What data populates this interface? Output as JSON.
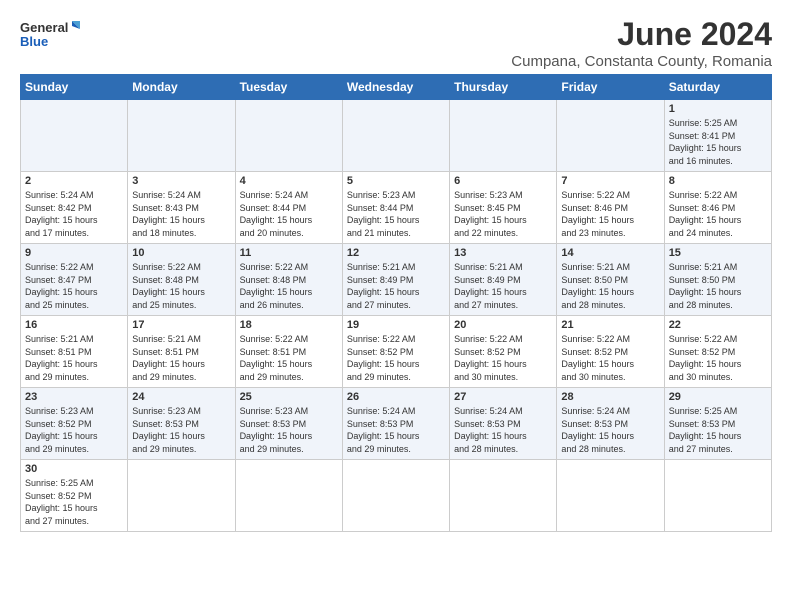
{
  "logo": {
    "text_general": "General",
    "text_blue": "Blue"
  },
  "title": "June 2024",
  "subtitle": "Cumpana, Constanta County, Romania",
  "weekdays": [
    "Sunday",
    "Monday",
    "Tuesday",
    "Wednesday",
    "Thursday",
    "Friday",
    "Saturday"
  ],
  "weeks": [
    [
      {
        "day": "",
        "info": ""
      },
      {
        "day": "",
        "info": ""
      },
      {
        "day": "",
        "info": ""
      },
      {
        "day": "",
        "info": ""
      },
      {
        "day": "",
        "info": ""
      },
      {
        "day": "",
        "info": ""
      },
      {
        "day": "1",
        "info": "Sunrise: 5:25 AM\nSunset: 8:41 PM\nDaylight: 15 hours\nand 16 minutes."
      }
    ],
    [
      {
        "day": "2",
        "info": "Sunrise: 5:24 AM\nSunset: 8:42 PM\nDaylight: 15 hours\nand 17 minutes."
      },
      {
        "day": "3",
        "info": "Sunrise: 5:24 AM\nSunset: 8:43 PM\nDaylight: 15 hours\nand 18 minutes."
      },
      {
        "day": "4",
        "info": "Sunrise: 5:24 AM\nSunset: 8:44 PM\nDaylight: 15 hours\nand 20 minutes."
      },
      {
        "day": "5",
        "info": "Sunrise: 5:23 AM\nSunset: 8:44 PM\nDaylight: 15 hours\nand 21 minutes."
      },
      {
        "day": "6",
        "info": "Sunrise: 5:23 AM\nSunset: 8:45 PM\nDaylight: 15 hours\nand 22 minutes."
      },
      {
        "day": "7",
        "info": "Sunrise: 5:22 AM\nSunset: 8:46 PM\nDaylight: 15 hours\nand 23 minutes."
      },
      {
        "day": "8",
        "info": "Sunrise: 5:22 AM\nSunset: 8:46 PM\nDaylight: 15 hours\nand 24 minutes."
      }
    ],
    [
      {
        "day": "9",
        "info": "Sunrise: 5:22 AM\nSunset: 8:47 PM\nDaylight: 15 hours\nand 25 minutes."
      },
      {
        "day": "10",
        "info": "Sunrise: 5:22 AM\nSunset: 8:48 PM\nDaylight: 15 hours\nand 25 minutes."
      },
      {
        "day": "11",
        "info": "Sunrise: 5:22 AM\nSunset: 8:48 PM\nDaylight: 15 hours\nand 26 minutes."
      },
      {
        "day": "12",
        "info": "Sunrise: 5:21 AM\nSunset: 8:49 PM\nDaylight: 15 hours\nand 27 minutes."
      },
      {
        "day": "13",
        "info": "Sunrise: 5:21 AM\nSunset: 8:49 PM\nDaylight: 15 hours\nand 27 minutes."
      },
      {
        "day": "14",
        "info": "Sunrise: 5:21 AM\nSunset: 8:50 PM\nDaylight: 15 hours\nand 28 minutes."
      },
      {
        "day": "15",
        "info": "Sunrise: 5:21 AM\nSunset: 8:50 PM\nDaylight: 15 hours\nand 28 minutes."
      }
    ],
    [
      {
        "day": "16",
        "info": "Sunrise: 5:21 AM\nSunset: 8:51 PM\nDaylight: 15 hours\nand 29 minutes."
      },
      {
        "day": "17",
        "info": "Sunrise: 5:21 AM\nSunset: 8:51 PM\nDaylight: 15 hours\nand 29 minutes."
      },
      {
        "day": "18",
        "info": "Sunrise: 5:22 AM\nSunset: 8:51 PM\nDaylight: 15 hours\nand 29 minutes."
      },
      {
        "day": "19",
        "info": "Sunrise: 5:22 AM\nSunset: 8:52 PM\nDaylight: 15 hours\nand 29 minutes."
      },
      {
        "day": "20",
        "info": "Sunrise: 5:22 AM\nSunset: 8:52 PM\nDaylight: 15 hours\nand 30 minutes."
      },
      {
        "day": "21",
        "info": "Sunrise: 5:22 AM\nSunset: 8:52 PM\nDaylight: 15 hours\nand 30 minutes."
      },
      {
        "day": "22",
        "info": "Sunrise: 5:22 AM\nSunset: 8:52 PM\nDaylight: 15 hours\nand 30 minutes."
      }
    ],
    [
      {
        "day": "23",
        "info": "Sunrise: 5:23 AM\nSunset: 8:52 PM\nDaylight: 15 hours\nand 29 minutes."
      },
      {
        "day": "24",
        "info": "Sunrise: 5:23 AM\nSunset: 8:53 PM\nDaylight: 15 hours\nand 29 minutes."
      },
      {
        "day": "25",
        "info": "Sunrise: 5:23 AM\nSunset: 8:53 PM\nDaylight: 15 hours\nand 29 minutes."
      },
      {
        "day": "26",
        "info": "Sunrise: 5:24 AM\nSunset: 8:53 PM\nDaylight: 15 hours\nand 29 minutes."
      },
      {
        "day": "27",
        "info": "Sunrise: 5:24 AM\nSunset: 8:53 PM\nDaylight: 15 hours\nand 28 minutes."
      },
      {
        "day": "28",
        "info": "Sunrise: 5:24 AM\nSunset: 8:53 PM\nDaylight: 15 hours\nand 28 minutes."
      },
      {
        "day": "29",
        "info": "Sunrise: 5:25 AM\nSunset: 8:53 PM\nDaylight: 15 hours\nand 27 minutes."
      }
    ],
    [
      {
        "day": "30",
        "info": "Sunrise: 5:25 AM\nSunset: 8:52 PM\nDaylight: 15 hours\nand 27 minutes."
      },
      {
        "day": "",
        "info": ""
      },
      {
        "day": "",
        "info": ""
      },
      {
        "day": "",
        "info": ""
      },
      {
        "day": "",
        "info": ""
      },
      {
        "day": "",
        "info": ""
      },
      {
        "day": "",
        "info": ""
      }
    ]
  ]
}
